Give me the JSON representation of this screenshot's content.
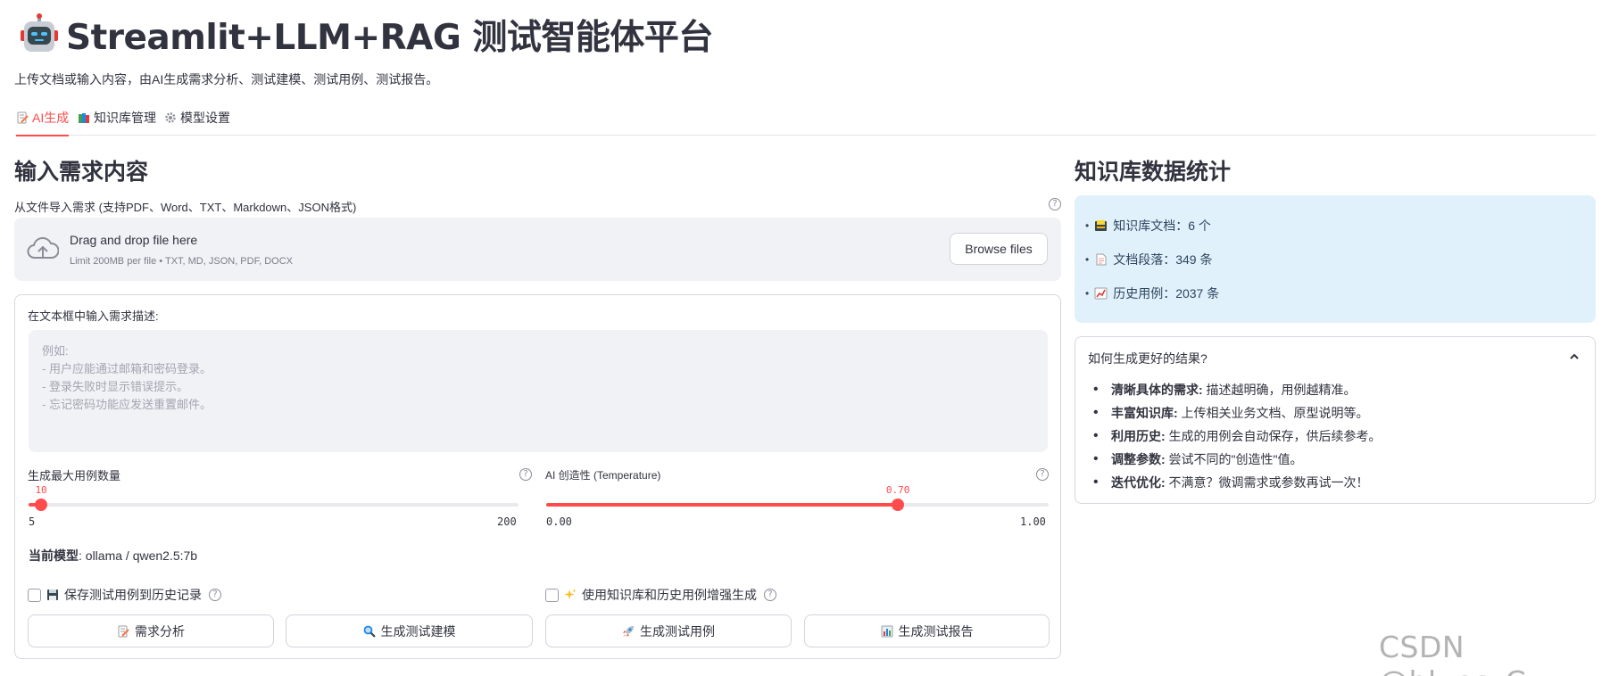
{
  "app": {
    "title": "Streamlit+LLM+RAG 测试智能体平台",
    "subtitle": "上传文档或输入内容，由AI生成需求分析、测试建模、测试用例、测试报告。"
  },
  "tabs": [
    {
      "label": "AI生成",
      "icon": "memo-icon",
      "active": true
    },
    {
      "label": "知识库管理",
      "icon": "books-icon",
      "active": false
    },
    {
      "label": "模型设置",
      "icon": "gear-icon",
      "active": false
    }
  ],
  "input_section": {
    "heading": "输入需求内容",
    "file_label": "从文件导入需求 (支持PDF、Word、TXT、Markdown、JSON格式)",
    "dropzone": {
      "main": "Drag and drop file here",
      "sub": "Limit 200MB per file • TXT, MD, JSON, PDF, DOCX",
      "browse": "Browse files"
    },
    "textarea": {
      "label": "在文本框中输入需求描述:",
      "placeholder": "例如:\n- 用户应能通过邮箱和密码登录。\n- 登录失败时显示错误提示。\n- 忘记密码功能应发送重置邮件。",
      "value": ""
    },
    "slider_max_cases": {
      "label": "生成最大用例数量",
      "value": 10,
      "value_text": "10",
      "min": 5,
      "max": 200,
      "min_text": "5",
      "max_text": "200"
    },
    "slider_temperature": {
      "label": "AI 创造性 (Temperature)",
      "value": 0.7,
      "value_text": "0.70",
      "min": 0.0,
      "max": 1.0,
      "min_text": "0.00",
      "max_text": "1.00"
    },
    "current_model": {
      "label": "当前模型",
      "value": ": ollama / qwen2.5:7b"
    },
    "checkboxes": [
      {
        "label": "保存测试用例到历史记录",
        "icon": "floppy-disk-icon",
        "checked": false
      },
      {
        "label": "使用知识库和历史用例增强生成",
        "icon": "sparkles-icon",
        "checked": false
      }
    ],
    "buttons": [
      {
        "label": "需求分析",
        "icon": "memo-icon"
      },
      {
        "label": "生成测试建模",
        "icon": "magnifier-icon"
      },
      {
        "label": "生成测试用例",
        "icon": "rocket-icon"
      },
      {
        "label": "生成测试报告",
        "icon": "bar-chart-icon"
      }
    ]
  },
  "stats_section": {
    "heading": "知识库数据统计",
    "items": [
      {
        "icon": "card-index-icon",
        "text": "知识库文档：6 个"
      },
      {
        "icon": "page-icon",
        "text": "文档段落：349 条"
      },
      {
        "icon": "chart-increasing-icon",
        "text": "历史用例：2037 条"
      }
    ]
  },
  "tips": {
    "title": "如何生成更好的结果?",
    "items": [
      {
        "bold": "清晰具体的需求:",
        "text": " 描述越明确，用例越精准。"
      },
      {
        "bold": "丰富知识库:",
        "text": " 上传相关业务文档、原型说明等。"
      },
      {
        "bold": "利用历史:",
        "text": " 生成的用例会自动保存，供后续参考。"
      },
      {
        "bold": "调整参数:",
        "text": " 尝试不同的\"创造性\"值。"
      },
      {
        "bold": "迭代优化:",
        "text": " 不满意？微调需求或参数再试一次！"
      }
    ]
  },
  "watermark": "CSDN @blues_C",
  "colors": {
    "accent": "#ff4b4b",
    "info_bg": "#e0f1fc",
    "info_text": "#30465e",
    "panel_bg": "#f0f2f6"
  }
}
